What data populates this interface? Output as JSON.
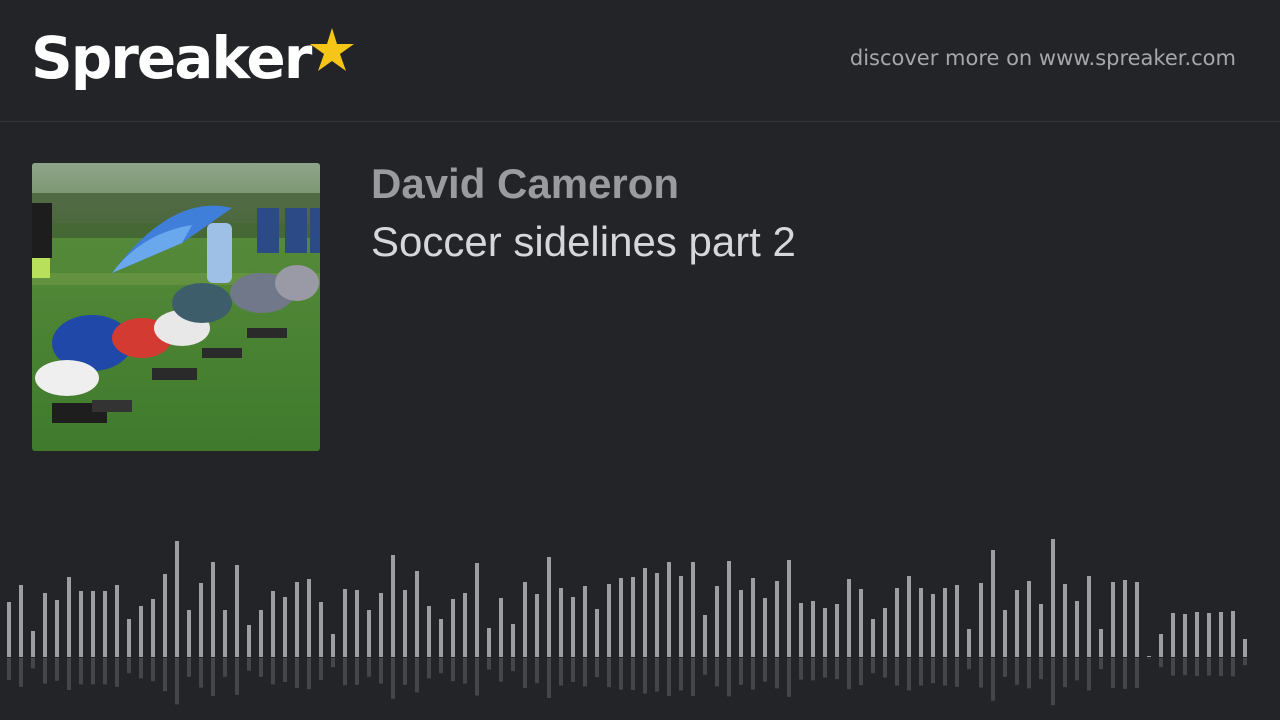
{
  "brand": {
    "name": "Spreaker",
    "star_color": "#f5c518"
  },
  "header": {
    "discover_text": "discover more on www.spreaker.com"
  },
  "episode": {
    "author": "David Cameron",
    "title": "Soccer sidelines part 2",
    "cover_icon": "podcast-cover-image"
  },
  "waveform": {
    "bar_color": "#9d9ea2",
    "levels": [
      55,
      72,
      26,
      64,
      57,
      80,
      66,
      66,
      66,
      72,
      38,
      51,
      58,
      83,
      116,
      47,
      74,
      95,
      47,
      92,
      32,
      47,
      66,
      60,
      75,
      78,
      55,
      23,
      68,
      67,
      47,
      64,
      102,
      67,
      86,
      51,
      38,
      58,
      64,
      94,
      29,
      59,
      33,
      75,
      63,
      100,
      69,
      60,
      71,
      48,
      73,
      79,
      80,
      89,
      84,
      95,
      81,
      95,
      42,
      71,
      96,
      67,
      79,
      59,
      76,
      97,
      54,
      56,
      49,
      53,
      78,
      68,
      38,
      49,
      69,
      81,
      69,
      63,
      69,
      72,
      28,
      74,
      107,
      47,
      67,
      76,
      53,
      118,
      73,
      56,
      81,
      28,
      75,
      77,
      75,
      1,
      23,
      44,
      43,
      45,
      44,
      45,
      46,
      18
    ]
  }
}
